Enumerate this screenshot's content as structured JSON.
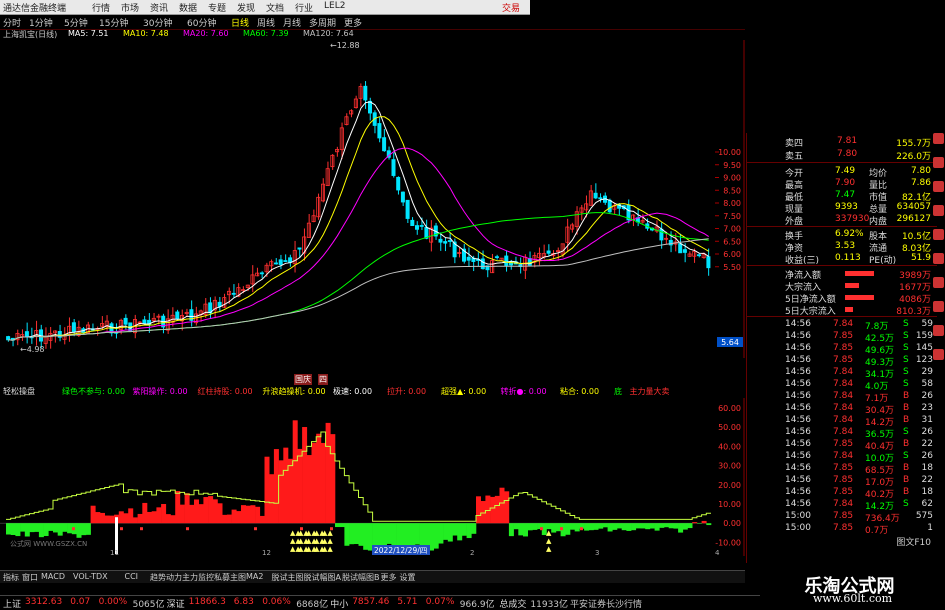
{
  "titlebar": {
    "app_name": "通达信金融终端",
    "menus": [
      "行情",
      "市场",
      "资讯",
      "数据",
      "专题",
      "发现",
      "文档",
      "行业",
      "LEL2"
    ],
    "right_label": "交易"
  },
  "period_bar": {
    "items": [
      "分时",
      "1分钟",
      "5分钟",
      "15分钟",
      "30分钟",
      "60分钟",
      "日线",
      "周线",
      "月线",
      "多周期",
      "更多"
    ],
    "active": "日线"
  },
  "ma_legend": {
    "stock": "上海凯宝(日线)",
    "items": [
      {
        "label": "MA5: 7.51",
        "color": "#ffffff"
      },
      {
        "label": "MA10: 7.48",
        "color": "#ffff00"
      },
      {
        "label": "MA20: 7.60",
        "color": "#ff00ff"
      },
      {
        "label": "MA60: 7.39",
        "color": "#00ff00"
      },
      {
        "label": "MA120: 7.64",
        "color": "#c0c0c0"
      }
    ]
  },
  "main_chart": {
    "price_labels": [
      "10.00",
      "9.50",
      "9.00",
      "8.50",
      "8.00",
      "7.50",
      "7.00",
      "6.50",
      "6.00",
      "5.50"
    ],
    "high_mark": "12.88",
    "low_mark": "4.98",
    "current_price_tag": "5.64",
    "top_tags": [
      "国庆",
      "四"
    ]
  },
  "indicator_bar": {
    "name": "轻松操盘",
    "items": [
      {
        "label": "绿色不参与",
        "value": "0.00",
        "color": "#00ff00"
      },
      {
        "label": "紫阳操作",
        "value": "0.00",
        "color": "#ff00ff"
      },
      {
        "label": "红柱持股",
        "value": "0.00",
        "color": "#ff3030"
      },
      {
        "label": "升浪趋操机",
        "value": "0.00",
        "color": "#ffff00"
      },
      {
        "label": "极速",
        "value": "0.00",
        "color": "#ffffff"
      },
      {
        "label": "拉升",
        "value": "0.00",
        "color": "#ff3030"
      },
      {
        "label": "超强▲",
        "value": "0.00",
        "color": "#ffff00"
      },
      {
        "label": "转折●",
        "value": "0.00",
        "color": "#ff00ff"
      },
      {
        "label": "粘合",
        "value": "0.00",
        "color": "#ffff00"
      },
      {
        "label": "底",
        "value": "",
        "color": "#00ff00"
      },
      {
        "label": "主力量大卖",
        "value": "",
        "color": "#ff3030"
      }
    ]
  },
  "sub_chart": {
    "axis_labels": [
      "60.00",
      "50.00",
      "40.00",
      "30.00",
      "20.00",
      "10.00",
      "0.00",
      "-10.00"
    ],
    "date_tag": "2022/12/29/四",
    "watermark": "公式网 WWW.GSZX.CN",
    "x_labels": [
      "11",
      "12",
      "2",
      "3",
      "4"
    ]
  },
  "right_panel": {
    "order_book": [
      {
        "label": "卖四",
        "price": "7.81",
        "vol": "155.7万"
      },
      {
        "label": "卖五",
        "price": "7.80",
        "vol": "226.0万"
      }
    ],
    "stats": [
      {
        "l1": "今开",
        "v1": "7.49",
        "l2": "均价",
        "v2": "7.80"
      },
      {
        "l1": "最高",
        "v1": "7.90",
        "l2": "量比",
        "v2": "7.86"
      },
      {
        "l1": "最低",
        "v1": "7.47",
        "l2": "市值",
        "v2": "82.1亿"
      },
      {
        "l1": "现量",
        "v1": "9393",
        "l2": "总量",
        "v2": "634057"
      },
      {
        "l1": "外盘",
        "v1": "337930",
        "l2": "内盘",
        "v2": "296127"
      },
      {
        "l1": "换手",
        "v1": "6.92%",
        "l2": "股本",
        "v2": "10.5亿"
      },
      {
        "l1": "净资",
        "v1": "3.53",
        "l2": "流通",
        "v2": "8.03亿"
      },
      {
        "l1": "收益(三)",
        "v1": "0.113",
        "l2": "PE(动)",
        "v2": "51.9"
      }
    ],
    "fund_flow": [
      {
        "label": "净流入额",
        "value": "3989万",
        "ratio": 0.95
      },
      {
        "label": "大宗流入",
        "value": "1677万",
        "ratio": 0.45
      },
      {
        "label": "5日净流入额",
        "value": "4086万",
        "ratio": 0.97
      },
      {
        "label": "5日大宗流入",
        "value": "810.3万",
        "ratio": 0.25
      }
    ],
    "ticks": [
      {
        "time": "14:56",
        "price": "7.84",
        "vol": "7.8万",
        "bs": "S",
        "n": "59"
      },
      {
        "time": "14:56",
        "price": "7.85",
        "vol": "42.5万",
        "bs": "S",
        "n": "159"
      },
      {
        "time": "14:56",
        "price": "7.85",
        "vol": "49.6万",
        "bs": "S",
        "n": "145"
      },
      {
        "time": "14:56",
        "price": "7.85",
        "vol": "49.3万",
        "bs": "S",
        "n": "123"
      },
      {
        "time": "14:56",
        "price": "7.84",
        "vol": "34.1万",
        "bs": "S",
        "n": "29"
      },
      {
        "time": "14:56",
        "price": "7.84",
        "vol": "4.0万",
        "bs": "S",
        "n": "58"
      },
      {
        "time": "14:56",
        "price": "7.84",
        "vol": "7.1万",
        "bs": "B",
        "n": "26"
      },
      {
        "time": "14:56",
        "price": "7.84",
        "vol": "30.4万",
        "bs": "B",
        "n": "23"
      },
      {
        "time": "14:56",
        "price": "7.84",
        "vol": "14.2万",
        "bs": "B",
        "n": "31"
      },
      {
        "time": "14:56",
        "price": "7.84",
        "vol": "36.5万",
        "bs": "S",
        "n": "26"
      },
      {
        "time": "14:56",
        "price": "7.85",
        "vol": "40.4万",
        "bs": "B",
        "n": "22"
      },
      {
        "time": "14:56",
        "price": "7.84",
        "vol": "10.0万",
        "bs": "S",
        "n": "26"
      },
      {
        "time": "14:56",
        "price": "7.85",
        "vol": "68.5万",
        "bs": "B",
        "n": "18"
      },
      {
        "time": "14:56",
        "price": "7.85",
        "vol": "17.0万",
        "bs": "B",
        "n": "22"
      },
      {
        "time": "14:56",
        "price": "7.85",
        "vol": "40.2万",
        "bs": "B",
        "n": "18"
      },
      {
        "time": "14:56",
        "price": "7.84",
        "vol": "14.2万",
        "bs": "S",
        "n": "62"
      },
      {
        "time": "15:00",
        "price": "7.85",
        "vol": "736.4万",
        "bs": "",
        "n": "575"
      },
      {
        "time": "15:00",
        "price": "7.85",
        "vol": "0.7万",
        "bs": "",
        "n": "1"
      }
    ],
    "footer": "图文F10"
  },
  "bottom_tabs": [
    "指标",
    "窗口",
    "MACD",
    "VOL-TDX",
    "CCI",
    "趋势动力",
    "主力监控",
    "私募主图",
    "MA2",
    "脱试主图",
    "脱试幅图A",
    "脱试幅图B",
    "更多",
    "设置"
  ],
  "status_bar": [
    {
      "label": "上证",
      "value": "3312.63",
      "color": "#ff3030"
    },
    {
      "label": "",
      "value": "0.07",
      "color": "#ff3030"
    },
    {
      "label": "",
      "value": "0.00%",
      "color": "#ff3030"
    },
    {
      "label": "",
      "value": "5065亿",
      "color": "#c8c8c8"
    },
    {
      "label": "深证",
      "value": "11866.3",
      "color": "#ff3030"
    },
    {
      "label": "",
      "value": "6.83",
      "color": "#ff3030"
    },
    {
      "label": "",
      "value": "0.06%",
      "color": "#ff3030"
    },
    {
      "label": "",
      "value": "6868亿",
      "color": "#c8c8c8"
    },
    {
      "label": "中小",
      "value": "7857.46",
      "color": "#ff3030"
    },
    {
      "label": "",
      "value": "5.71",
      "color": "#ff3030"
    },
    {
      "label": "",
      "value": "0.07%",
      "color": "#ff3030"
    },
    {
      "label": "",
      "value": "966.9亿",
      "color": "#c8c8c8"
    },
    {
      "label": "总成交",
      "value": "11933亿",
      "color": "#c8c8c8"
    },
    {
      "label": "",
      "value": "平安证券长沙行情",
      "color": "#c8c8c8"
    }
  ],
  "watermark": {
    "line1": "乐淘公式网",
    "line2": "www.60lt.com"
  }
}
